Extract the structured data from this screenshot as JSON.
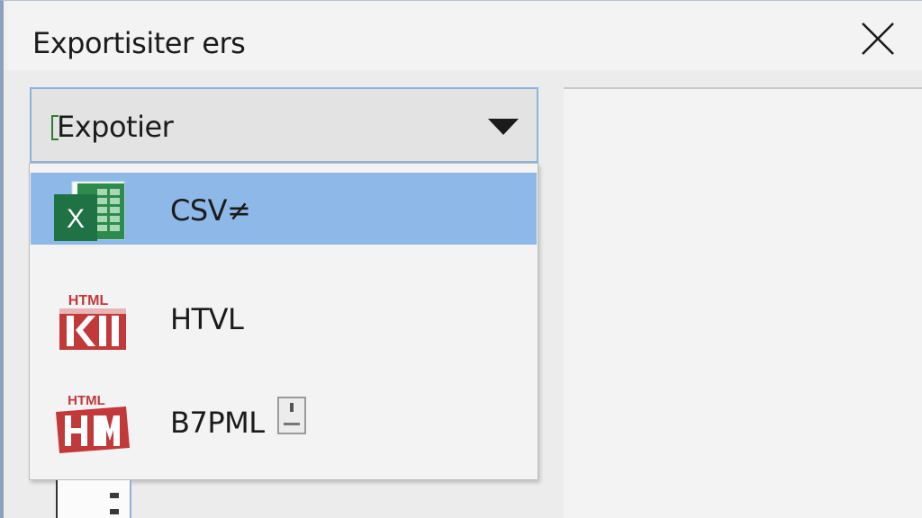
{
  "window": {
    "title": "Exportisiter ers",
    "close_icon": "close-icon"
  },
  "export_select": {
    "value": "Expotier",
    "arrow_icon": "chevron-down-icon"
  },
  "dropdown": {
    "items": [
      {
        "label": "CSV≠",
        "icon": "excel-icon",
        "selected": true
      },
      {
        "label": "HTVL",
        "icon": "html-file-icon",
        "selected": false
      },
      {
        "label": "B7PML",
        "icon": "html-file-icon",
        "selected": false
      }
    ],
    "icon_labels": {
      "html_1": "HTML",
      "html_2": "HTML",
      "excel": "X"
    }
  },
  "colors": {
    "selection": "#8db8e8",
    "combo_border": "#8bb3dc",
    "excel_green": "#1f7244",
    "html_red": "#c2393a"
  }
}
